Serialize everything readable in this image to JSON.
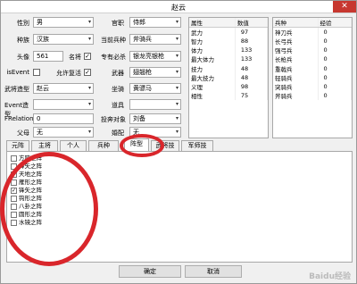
{
  "window": {
    "title": "赵云",
    "close_symbol": "✕"
  },
  "form": {
    "gender_label": "性別",
    "gender_value": "男",
    "official_label": "官职",
    "official_value": "侍郎",
    "race_label": "种族",
    "race_value": "汉族",
    "cur_troop_label": "当前兵种",
    "cur_troop_value": "斧骑兵",
    "face_label": "头像",
    "face_value": "561",
    "famous_label": "名将",
    "exclusive_label": "专有必杀",
    "exclusive_value": "银龙亮银枪",
    "isevent_label": "isEvent",
    "allow_label": "允许复活",
    "weapon_label": "武器",
    "weapon_value": "翅翘枪",
    "model_label": "武将造型",
    "model_value": "赵云",
    "mount_label": "坐骑",
    "mount_value": "黄骠马",
    "eventmodel_label": "Event造型",
    "item_label": "道具",
    "frelation_label": "FRelation",
    "frelation_value": "0",
    "target_label": "投奔对象",
    "target_value": "刘备",
    "father_label": "父母",
    "father_value": "无",
    "spouse_label": "婚配",
    "spouse_value": "无"
  },
  "attributes": {
    "headers": [
      "属性",
      "数值"
    ],
    "rows": [
      [
        "武力",
        "97"
      ],
      [
        "智力",
        "88"
      ],
      [
        "体力",
        "133"
      ],
      [
        "最大体力",
        "133"
      ],
      [
        "技力",
        "48"
      ],
      [
        "最大技力",
        "48"
      ],
      [
        "义理",
        "98"
      ],
      [
        "相性",
        "75"
      ]
    ]
  },
  "troops": {
    "headers": [
      "兵种",
      "经验"
    ],
    "rows": [
      [
        "神刀兵",
        "0"
      ],
      [
        "长弓兵",
        "0"
      ],
      [
        "强弓兵",
        "0"
      ],
      [
        "长枪兵",
        "0"
      ],
      [
        "重戟兵",
        "0"
      ],
      [
        "轻骑兵",
        "0"
      ],
      [
        "突骑兵",
        "0"
      ],
      [
        "斧骑兵",
        "0"
      ]
    ]
  },
  "tabs": [
    "元阵",
    "主将",
    "个人",
    "兵种",
    "阵型",
    "武将技",
    "军师技"
  ],
  "formations": [
    {
      "label": "方阵之阵",
      "checked": false
    },
    {
      "label": "锋矢之阵",
      "checked": false
    },
    {
      "label": "天地之阵",
      "checked": false
    },
    {
      "label": "雁形之阵",
      "checked": false
    },
    {
      "label": "锋矢之阵",
      "checked": true
    },
    {
      "label": "钩形之阵",
      "checked": false
    },
    {
      "label": "八卦之阵",
      "checked": false
    },
    {
      "label": "圆形之阵",
      "checked": false
    },
    {
      "label": "水镜之阵",
      "checked": false
    }
  ],
  "buttons": {
    "ok": "确定",
    "cancel": "取消"
  },
  "watermark": "Baidu经验",
  "colors": {
    "annotation_red": "#d9262b",
    "close_red": "#c7372f"
  },
  "checkmark": "✓",
  "dropdown_arrow": "▾"
}
